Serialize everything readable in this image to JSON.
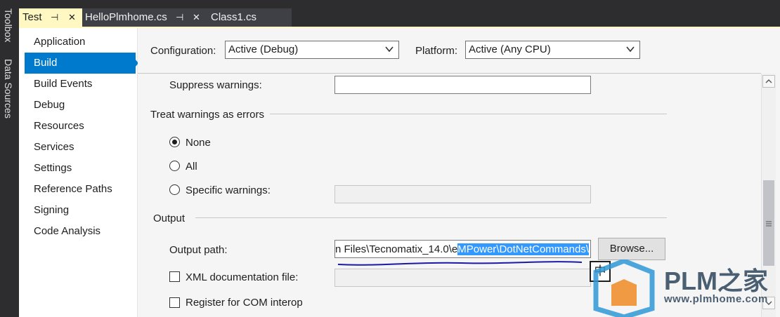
{
  "toolstrip": {
    "items": [
      "Toolbox",
      "Data Sources"
    ]
  },
  "tabs": [
    {
      "label": "Test"
    },
    {
      "label": "HelloPlmhome.cs"
    },
    {
      "label": "Class1.cs"
    }
  ],
  "nav": {
    "items": [
      "Application",
      "Build",
      "Build Events",
      "Debug",
      "Resources",
      "Services",
      "Settings",
      "Reference Paths",
      "Signing",
      "Code Analysis"
    ],
    "active": "Build"
  },
  "config": {
    "configuration_label": "Configuration:",
    "configuration_value": "Active (Debug)",
    "platform_label": "Platform:",
    "platform_value": "Active (Any CPU)"
  },
  "build": {
    "suppress_warnings_label": "Suppress warnings:",
    "suppress_warnings_value": "",
    "treat_warnings_header": "Treat warnings as errors",
    "radio_none": "None",
    "radio_all": "All",
    "radio_specific": "Specific warnings:",
    "selected_radio": "None",
    "output_header": "Output",
    "output_path_label": "Output path:",
    "output_path_plain": "n Files\\Tecnomatix_14.0\\e",
    "output_path_selected": "MPower\\DotNetCommands\\",
    "browse_label": "Browse...",
    "xml_doc_label": "XML documentation file:",
    "xml_doc_checked": false,
    "com_interop_label": "Register for COM interop",
    "com_interop_checked": false
  },
  "ime": {
    "char": "中"
  },
  "watermark": {
    "text": "PLM之家",
    "url": "www.plmhome.com"
  },
  "colors": {
    "accent": "#007acc",
    "chrome": "#2d2d30",
    "selection": "#3399ff",
    "annotation": "#1a1aa6"
  }
}
